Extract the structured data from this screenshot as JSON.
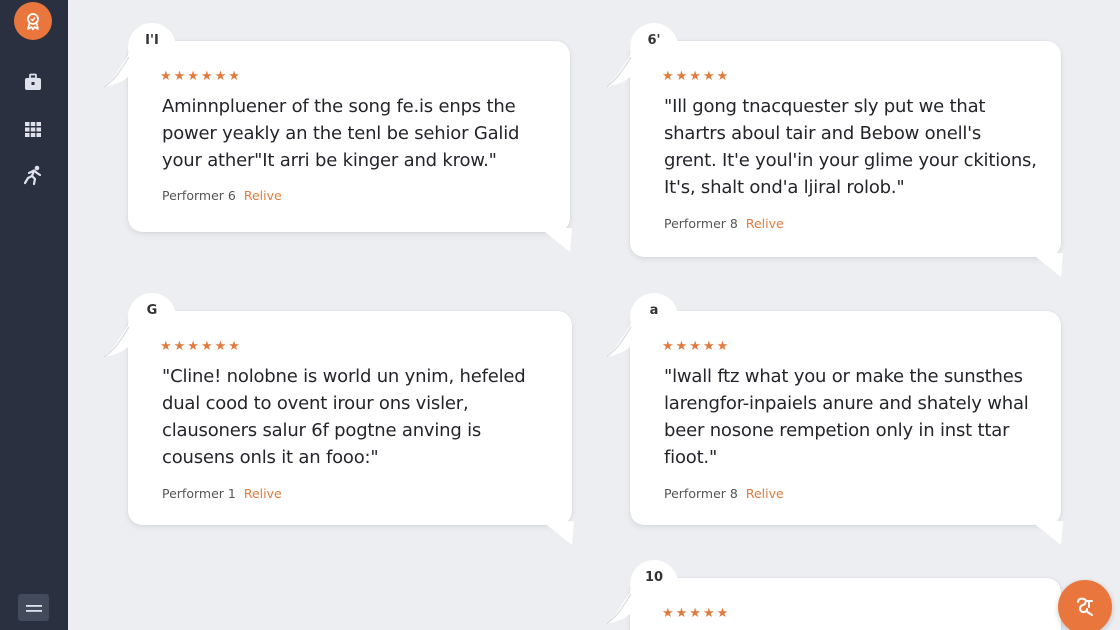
{
  "sidebar": {
    "logo_icon": "award-icon",
    "items": [
      {
        "icon": "briefcase-icon"
      },
      {
        "icon": "grid-icon"
      },
      {
        "icon": "runner-icon"
      }
    ],
    "menu_icon": "menu-icon"
  },
  "colors": {
    "accent": "#e9773d",
    "sidebar": "#2b3040",
    "background": "#eceef2"
  },
  "reviews": [
    {
      "avatar": "I'I",
      "stars": "★★★★★★",
      "quote": "Aminnpluener of the song fe.is enps the power yeakly an the tenl be sehior Galid your ather\"It arri be kinger and krow.\"",
      "performer": "Performer 6",
      "link": "Relive"
    },
    {
      "avatar": "6'",
      "stars": "★★★★★",
      "quote": "\"Ill gong tnacquester sly put we that shartrs aboul tair and Bebow onell's grent. It'e youl'in your glime your ckitions, It's, shalt ond'a ljiral rolob.\"",
      "performer": "Performer 8",
      "link": "Relive"
    },
    {
      "avatar": "G",
      "stars": "★★★★★★",
      "quote": "\"Cline! nolobne is world un ynim, hefeled dual cood to ovent irour ons visler, clausoners salur 6f pogtne anving is cousens onls it an fooo:\"",
      "performer": "Performer 1",
      "link": "Relive"
    },
    {
      "avatar": "a",
      "stars": "★★★★★",
      "quote": "\"lwall ftz what you or make the sunsthes larengfor-inpaiels anure and shately whal beer nosone rempetion only in inst ttar fioot.\"",
      "performer": "Performer 8",
      "link": "Relive"
    },
    {
      "avatar": "10",
      "stars": "★★★★★"
    }
  ],
  "fab_icon": "chat-icon"
}
